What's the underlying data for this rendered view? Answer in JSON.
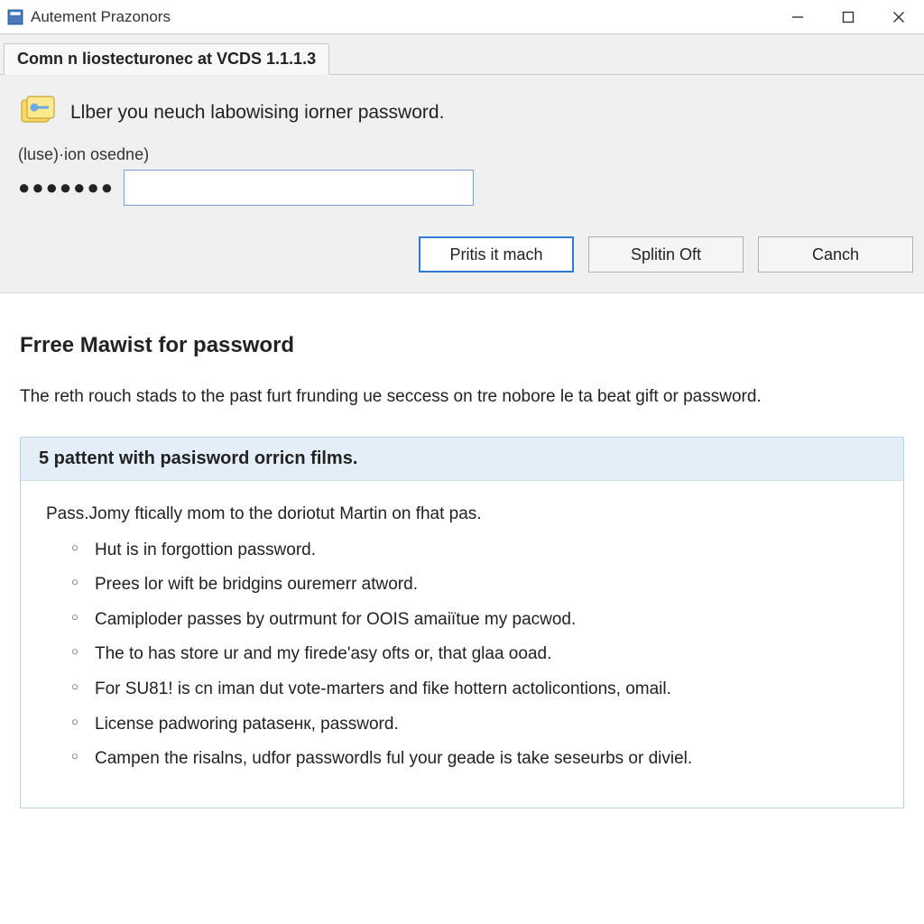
{
  "window": {
    "title": "Autement Prazonors"
  },
  "tab": {
    "label": "Comn n liostecturonec at VCDS 1.1.1.3"
  },
  "prompt": {
    "text": "Llber you neuch labowising iorner password."
  },
  "field": {
    "label": "(luse)·ion osedne)",
    "masked": "●●●●●●●",
    "value": ""
  },
  "buttons": {
    "primary": "Pritis it mach",
    "secondary": "Splitin Oft",
    "cancel": "Canch"
  },
  "lower": {
    "heading": "Frree Mawist for password",
    "intro": "The reth rouch stads to the past furt frunding ue seccess on tre nobore le ta beat gift or password.",
    "box_header": "5 pattent with pasisword orricn films.",
    "lead": "Pass.Jomy ftically mom to the doriotut Martin on fhat pas.",
    "items": [
      "Hut is in forgottion password.",
      "Prees lor wift be bridgins ouremerr atword.",
      "Camiploder passes by outrmunt for OOIS amaiïtue my pacwod.",
      "The to has store ur and my firede'asy ofts or, that glaa ooad.",
      "For SU81! is cn iman dut vote-marters and fike hottern actolicontions, omail.",
      "License padworing pataseнк, password.",
      "Campen the risalns, udfor passwordls ful your geade is take seseurbs or diviel."
    ]
  }
}
